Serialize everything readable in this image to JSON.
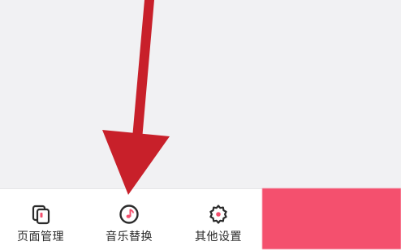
{
  "bottom_nav": {
    "tabs": [
      {
        "label": "页面管理",
        "icon": "pages-icon"
      },
      {
        "label": "音乐替换",
        "icon": "music-note-icon"
      },
      {
        "label": "其他设置",
        "icon": "gear-icon"
      }
    ],
    "primary_button": {
      "label": ""
    }
  },
  "colors": {
    "accent": "#f4506e",
    "arrow": "#c8202a",
    "icon": "#2b2b2b",
    "background": "#f1f1f3"
  }
}
